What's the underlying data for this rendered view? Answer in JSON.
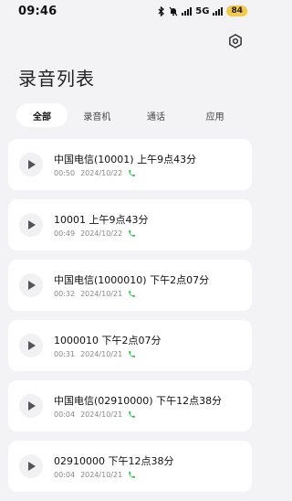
{
  "status_bar": {
    "time": "09:46",
    "network": "5G",
    "battery": "84"
  },
  "header": {
    "title": "录音列表",
    "settings_icon": "gear-icon"
  },
  "tabs": [
    {
      "label": "全部",
      "active": true
    },
    {
      "label": "录音机",
      "active": false
    },
    {
      "label": "通话",
      "active": false
    },
    {
      "label": "应用",
      "active": false
    }
  ],
  "recordings": [
    {
      "name": "中国电信(10001) 上午9点43分",
      "duration": "00:50",
      "date": "2024/10/22"
    },
    {
      "name": "10001 上午9点43分",
      "duration": "00:49",
      "date": "2024/10/22"
    },
    {
      "name": "中国电信(1000010) 下午2点07分",
      "duration": "00:32",
      "date": "2024/10/21"
    },
    {
      "name": "1000010 下午2点07分",
      "duration": "00:31",
      "date": "2024/10/21"
    },
    {
      "name": "中国电信(02910000) 下午12点38分",
      "duration": "00:04",
      "date": "2024/10/21"
    },
    {
      "name": "02910000 下午12点38分",
      "duration": "00:04",
      "date": "2024/10/21"
    }
  ],
  "colors": {
    "call_icon": "#2fbf4a",
    "battery_bg": "#f2c94c",
    "background": "#f3f3f5"
  }
}
